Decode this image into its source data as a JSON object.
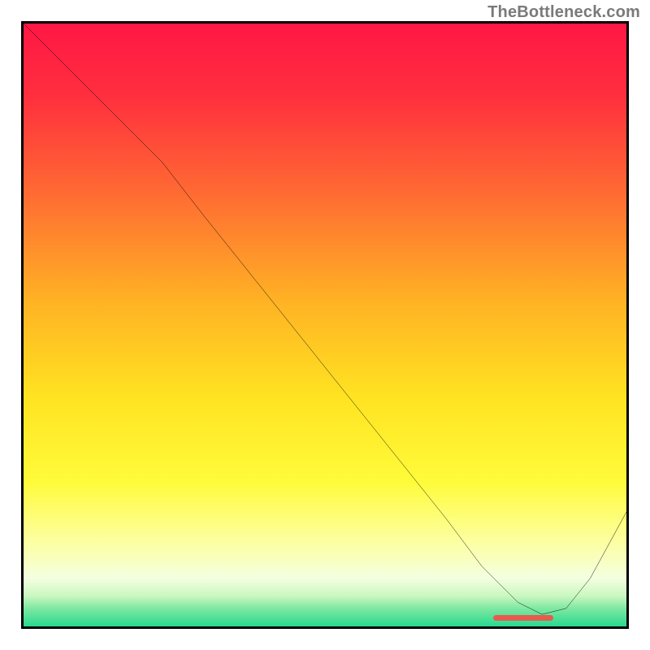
{
  "attribution": "TheBottleneck.com",
  "chart_data": {
    "type": "line",
    "title": "",
    "xlabel": "",
    "ylabel": "",
    "xlim": [
      0,
      100
    ],
    "ylim": [
      0,
      100
    ],
    "gradient_stops": [
      {
        "offset": 0,
        "color": "#ff1745"
      },
      {
        "offset": 12,
        "color": "#ff2f3e"
      },
      {
        "offset": 28,
        "color": "#ff6a33"
      },
      {
        "offset": 46,
        "color": "#ffb224"
      },
      {
        "offset": 62,
        "color": "#ffe321"
      },
      {
        "offset": 76,
        "color": "#fffb3a"
      },
      {
        "offset": 86,
        "color": "#fcffa1"
      },
      {
        "offset": 92,
        "color": "#f4ffe0"
      },
      {
        "offset": 95,
        "color": "#c9f7c0"
      },
      {
        "offset": 97,
        "color": "#7fe8a2"
      },
      {
        "offset": 100,
        "color": "#28d98f"
      }
    ],
    "series": [
      {
        "name": "curve",
        "x": [
          0,
          6,
          12,
          18,
          23,
          30,
          38,
          46,
          54,
          62,
          70,
          76,
          82,
          86,
          90,
          94,
          100
        ],
        "y": [
          100,
          94,
          88,
          82,
          77,
          68,
          58,
          48,
          38,
          28,
          18,
          10,
          4,
          2,
          3,
          8,
          19
        ]
      }
    ],
    "annotations": [
      {
        "name": "optimal-marker",
        "x_start": 78,
        "x_end": 88,
        "y": 1.3,
        "color": "#e85a4f"
      }
    ]
  }
}
